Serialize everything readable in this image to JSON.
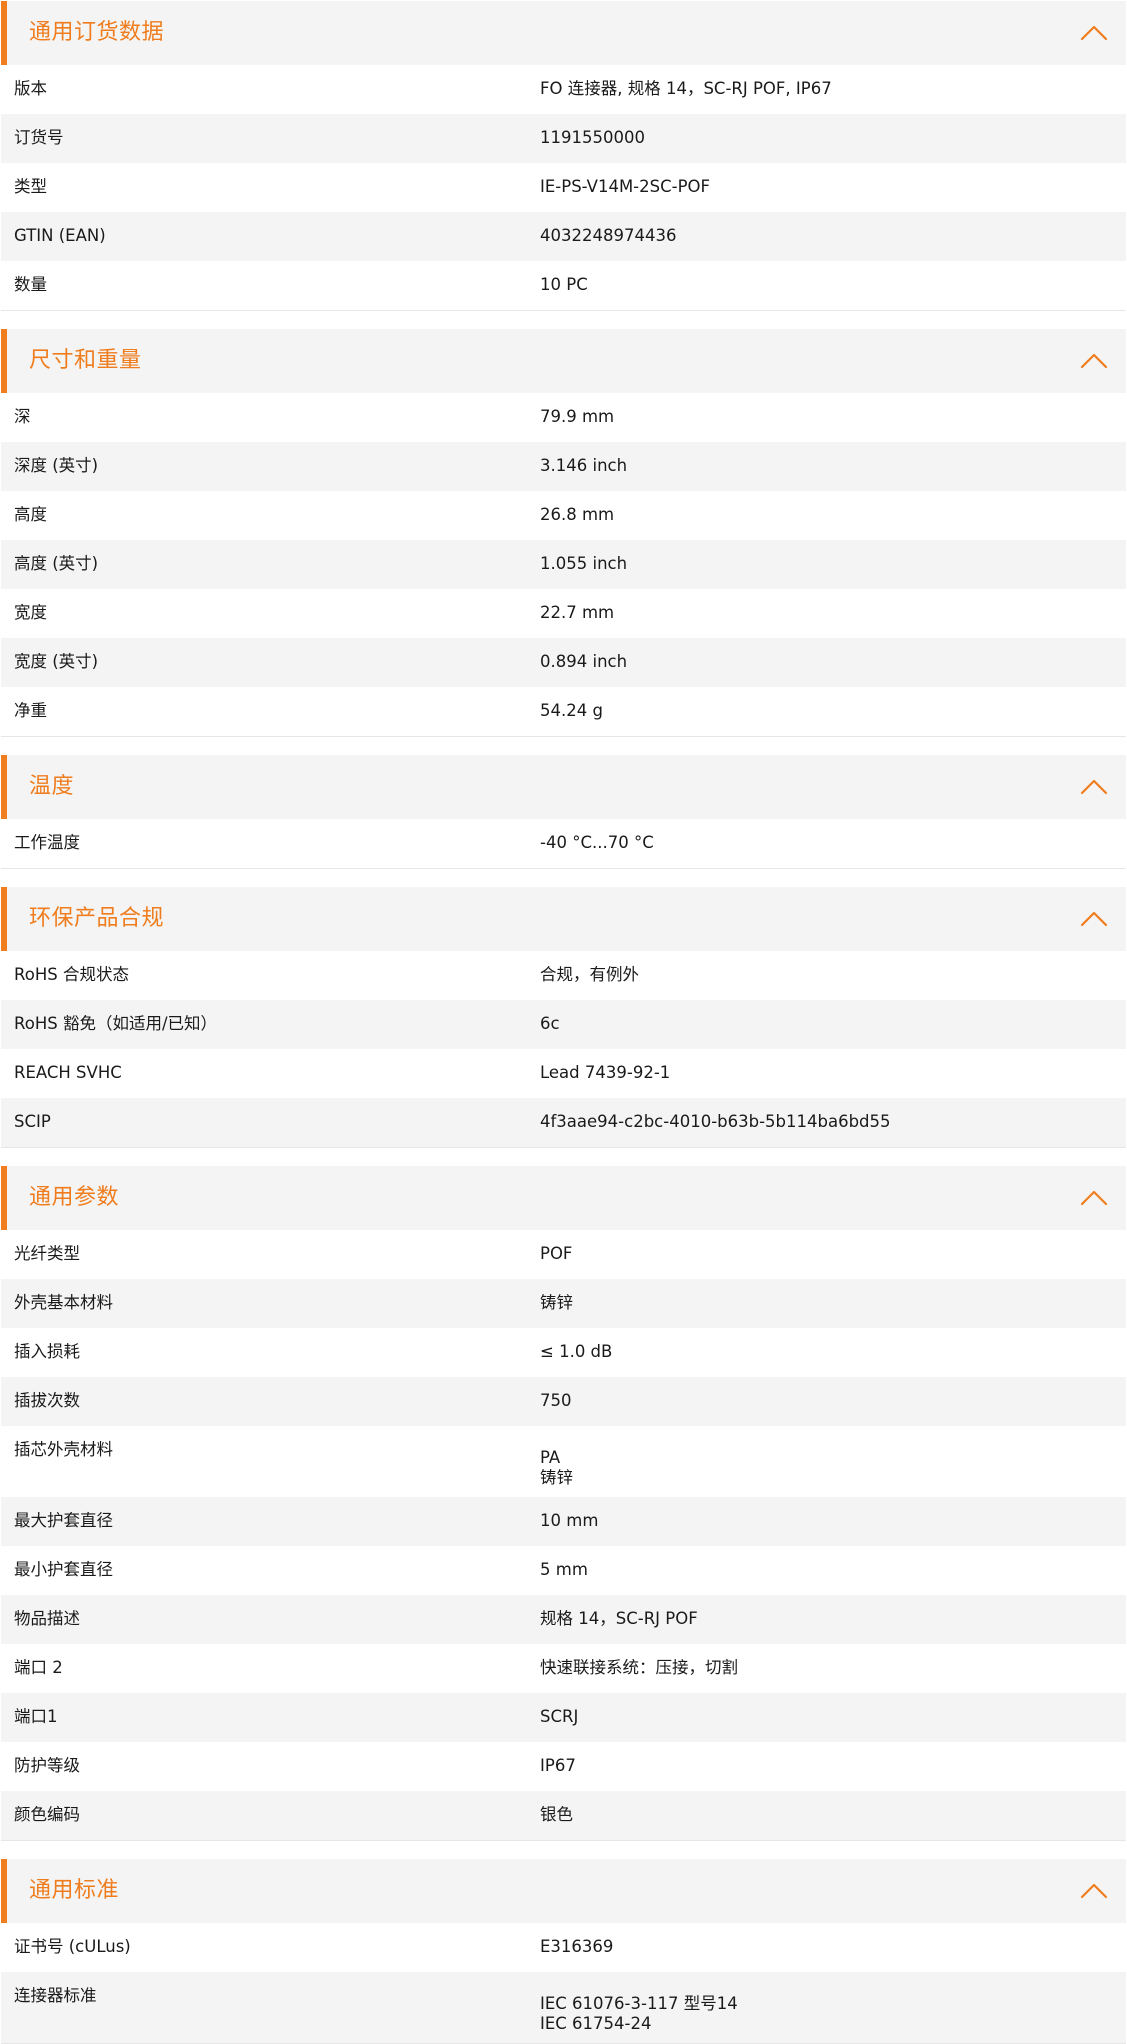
{
  "sections": [
    {
      "title": "通用订货数据",
      "rows": [
        {
          "label": "版本",
          "value": [
            "FO 连接器, 规格 14，SC-RJ POF, IP67"
          ]
        },
        {
          "label": "订货号",
          "value": [
            "1191550000"
          ]
        },
        {
          "label": "类型",
          "value": [
            "IE-PS-V14M-2SC-POF"
          ]
        },
        {
          "label": "GTIN (EAN)",
          "value": [
            "4032248974436"
          ]
        },
        {
          "label": "数量",
          "value": [
            "10  PC"
          ]
        }
      ]
    },
    {
      "title": "尺寸和重量",
      "rows": [
        {
          "label": "深",
          "value": [
            "79.9  mm"
          ]
        },
        {
          "label": "深度 (英寸)",
          "value": [
            "3.146  inch"
          ]
        },
        {
          "label": "高度",
          "value": [
            "26.8  mm"
          ]
        },
        {
          "label": "高度 (英寸)",
          "value": [
            "1.055  inch"
          ]
        },
        {
          "label": "宽度",
          "value": [
            "22.7  mm"
          ]
        },
        {
          "label": "宽度 (英寸)",
          "value": [
            "0.894  inch"
          ]
        },
        {
          "label": "净重",
          "value": [
            "54.24  g"
          ]
        }
      ]
    },
    {
      "title": "温度",
      "rows": [
        {
          "label": "工作温度",
          "value": [
            "-40 °C...70 °C"
          ]
        }
      ]
    },
    {
      "title": "环保产品合规",
      "rows": [
        {
          "label": "RoHS 合规状态",
          "value": [
            "合规，有例外"
          ]
        },
        {
          "label": "RoHS 豁免（如适用/已知）",
          "value": [
            "6c"
          ]
        },
        {
          "label": "REACH SVHC",
          "value": [
            "Lead 7439-92-1"
          ]
        },
        {
          "label": "SCIP",
          "value": [
            "4f3aae94-c2bc-4010-b63b-5b114ba6bd55"
          ]
        }
      ]
    },
    {
      "title": "通用参数",
      "rows": [
        {
          "label": "光纤类型",
          "value": [
            "POF"
          ]
        },
        {
          "label": "外壳基本材料",
          "value": [
            "铸锌"
          ]
        },
        {
          "label": "插入损耗",
          "value": [
            "≤ 1.0 dB"
          ]
        },
        {
          "label": "插拔次数",
          "value": [
            "750"
          ]
        },
        {
          "label": "插芯外壳材料",
          "value": [
            "PA",
            "铸锌"
          ]
        },
        {
          "label": "最大护套直径",
          "value": [
            "10  mm"
          ]
        },
        {
          "label": "最小护套直径",
          "value": [
            "5  mm"
          ]
        },
        {
          "label": "物品描述",
          "value": [
            "规格 14，SC-RJ POF"
          ]
        },
        {
          "label": "端口 2",
          "value": [
            "快速联接系统：压接，切割"
          ]
        },
        {
          "label": "端口1",
          "value": [
            "SCRJ"
          ]
        },
        {
          "label": "防护等级",
          "value": [
            "IP67"
          ]
        },
        {
          "label": "颜色编码",
          "value": [
            "银色"
          ]
        }
      ]
    },
    {
      "title": "通用标准",
      "rows": [
        {
          "label": "证书号 (cULus)",
          "value": [
            "E316369"
          ]
        },
        {
          "label": "连接器标准",
          "value": [
            "IEC 61076-3-117 型号14",
            "IEC 61754-24"
          ]
        }
      ]
    }
  ],
  "icons": {
    "toggle": "chevron-up-icon"
  },
  "colors": {
    "accent": "#f07d1e",
    "header_bg": "#f4f4f4",
    "row_alt_bg": "#f4f4f4"
  }
}
